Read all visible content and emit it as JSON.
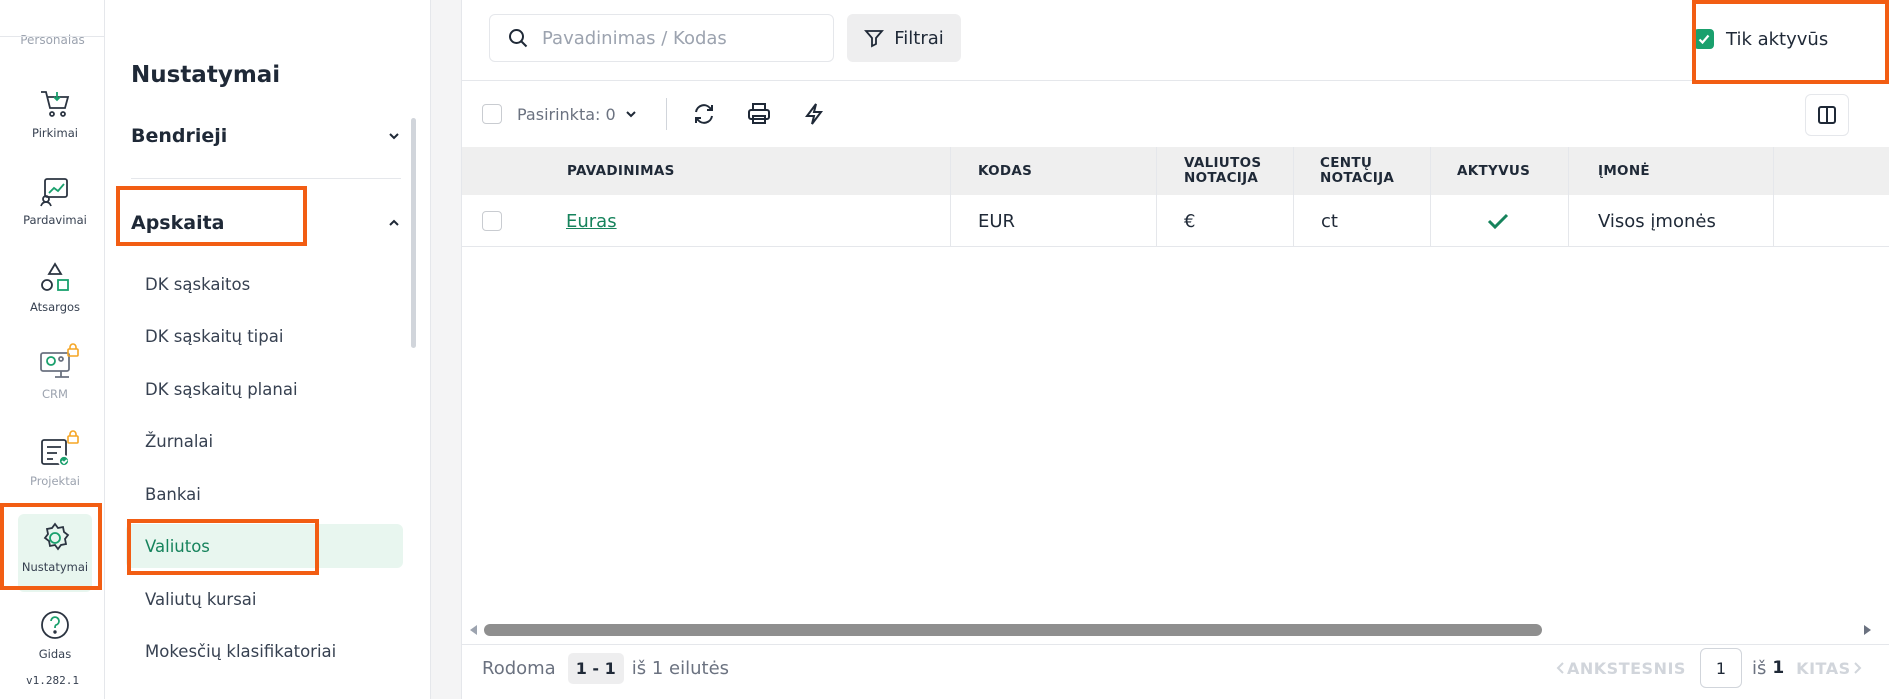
{
  "rail": {
    "top_label": "Personalas",
    "items": [
      {
        "label": "Pirkimai",
        "icon": "cart-icon"
      },
      {
        "label": "Pardavimai",
        "icon": "sales-chart-icon"
      },
      {
        "label": "Atsargos",
        "icon": "shapes-icon"
      },
      {
        "label": "CRM",
        "icon": "crm-icon"
      },
      {
        "label": "Projektai",
        "icon": "projects-icon"
      },
      {
        "label": "Nustatymai",
        "icon": "gear-icon"
      },
      {
        "label": "Gidas",
        "icon": "help-icon"
      }
    ],
    "version": "v1.282.1"
  },
  "sidebar": {
    "title": "Nustatymai",
    "sections": [
      {
        "label": "Bendrieji",
        "expanded": false
      },
      {
        "label": "Apskaita",
        "expanded": true
      }
    ],
    "items": [
      {
        "label": "DK sąskaitos"
      },
      {
        "label": "DK sąskaitų tipai"
      },
      {
        "label": "DK sąskaitų planai"
      },
      {
        "label": "Žurnalai"
      },
      {
        "label": "Bankai"
      },
      {
        "label": "Valiutos",
        "active": true
      },
      {
        "label": "Valiutų kursai"
      },
      {
        "label": "Mokesčių klasifikatoriai"
      }
    ]
  },
  "search": {
    "placeholder": "Pavadinimas / Kodas"
  },
  "filter": {
    "label": "Filtrai"
  },
  "active_only": {
    "label": "Tik aktyvūs",
    "checked": true
  },
  "toolbar": {
    "selected_label": "Pasirinkta: 0"
  },
  "table": {
    "columns": [
      {
        "line1": "PAVADINIMAS",
        "line2": ""
      },
      {
        "line1": "KODAS",
        "line2": ""
      },
      {
        "line1": "VALIUTOS",
        "line2": "NOTACIJA"
      },
      {
        "line1": "CENTŲ",
        "line2": "NOTACIJA"
      },
      {
        "line1": "AKTYVUS",
        "line2": ""
      },
      {
        "line1": "ĮMONĖ",
        "line2": ""
      }
    ],
    "rows": [
      {
        "name": "Euras",
        "code": "EUR",
        "currency_notation": "€",
        "cents_notation": "ct",
        "active": true,
        "company": "Visos įmonės"
      }
    ]
  },
  "footer": {
    "showing": "Rodoma",
    "range": "1 - 1",
    "of_rows": "iš 1 eilutės",
    "prev": "ANKSTESNIS",
    "page": "1",
    "of": "iš",
    "total_pages": "1",
    "next": "KITAS"
  },
  "colors": {
    "accent": "#16835c",
    "highlight": "#f25d13",
    "checkbox": "#1aa06d"
  }
}
